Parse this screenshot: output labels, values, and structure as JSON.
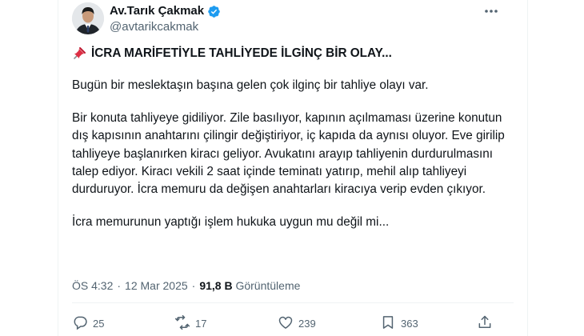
{
  "author": {
    "name": "Av.Tarık Çakmak",
    "handle": "@avtarikcakmak",
    "verified_color": "#1d9bf0"
  },
  "post": {
    "headline_icon": "pushpin-icon",
    "headline": "İCRA MARİFETİYLE TAHLİYEDE İLGİNÇ BİR OLAY...",
    "paragraphs": [
      "Bugün bir meslektaşın başına gelen çok ilginç bir tahliye olayı var.",
      "Bir konuta tahliyeye gidiliyor. Zile basılıyor, kapının açılmaması üzerine konutun dış kapısının anahtarını çilingir değiştiriyor, iç kapıda da aynısı oluyor. Eve girilip tahliyeye başlanırken kiracı geliyor. Avukatını arayıp tahliyenin durdurulmasını talep ediyor. Kiracı vekili 2 saat içinde teminatı yatırıp, mehil alıp tahliyeyi durduruyor. İcra memuru da değişen anahtarları kiracıya verip evden çıkıyor.",
      "İcra memurunun yaptığı işlem hukuka uygun mu değil mi..."
    ]
  },
  "meta": {
    "time": "ÖS 4:32",
    "separator": "·",
    "date": "12 Mar 2025",
    "views_count": "91,8 B",
    "views_label": "Görüntüleme"
  },
  "actions": {
    "replies": "25",
    "reposts": "17",
    "likes": "239",
    "bookmarks": "363"
  },
  "colors": {
    "text": "#0f1419",
    "secondary": "#536471",
    "accent": "#1d9bf0",
    "divider": "#eff3f4"
  }
}
